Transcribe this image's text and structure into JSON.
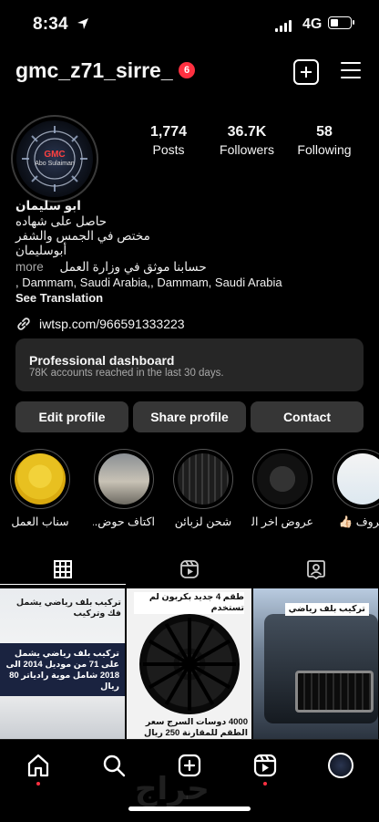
{
  "status_bar": {
    "time": "8:34",
    "network": "4G"
  },
  "header": {
    "username": "gmc_z71_sirre_",
    "notification_count": "6"
  },
  "avatar": {
    "logo_text": "GMC",
    "logo_subtext": "Abo Sulaiman"
  },
  "stats": [
    {
      "value": "1,774",
      "label": "Posts"
    },
    {
      "value": "36.7K",
      "label": "Followers"
    },
    {
      "value": "58",
      "label": "Following"
    }
  ],
  "bio": {
    "name": "ابو سليمان",
    "line1": "حاصل على شهاده",
    "line2": "مختص في الجمس والشفر",
    "line3": "أبوسليمان",
    "more_label": "more",
    "verified_line": "حسابنا موثق في وزارة العمل",
    "location": ", Dammam, Saudi Arabia,, Dammam, Saudi Arabia",
    "translation": "See Translation"
  },
  "link": {
    "text": "iwtsp.com/966591333223"
  },
  "dashboard": {
    "title": "Professional dashboard",
    "subtitle": "78K accounts reached in the last 30 days."
  },
  "buttons": {
    "edit": "Edit profile",
    "share": "Share profile",
    "contact": "Contact"
  },
  "highlights": [
    {
      "label": "سناب العمل"
    },
    {
      "label": "اكتاف حوض..."
    },
    {
      "label": "شحن لزبائن"
    },
    {
      "label": "عروض اخر السـ..."
    },
    {
      "label": "حروف 👍🏻"
    }
  ],
  "posts": [
    {
      "caption_top": "تركيب بلف رياضي يشمل فك وتركيب",
      "caption_bottom": "تركيب بلف رياضي يشمل على 71 من موديل 2014 الى 2018 شامل موية رادياتر 80 ريال"
    },
    {
      "caption_top": "طقم 4 جديد بكربون لم تستخدم",
      "caption_bottom": "4000 دوسات السرج سعر الطقم للمقارنة 250 ريال"
    },
    {
      "caption_top": "تركيب بلف رياضي",
      "caption_bottom": ""
    }
  ],
  "nav": {
    "watermark": "حراج"
  },
  "icons": {
    "location": "location-arrow-icon",
    "signal": "cellular-signal-icon",
    "battery": "battery-icon",
    "new_post": "plus-square-icon",
    "menu": "hamburger-menu-icon",
    "link": "link-chain-icon",
    "grid": "grid-icon",
    "reels": "reels-icon",
    "tagged": "tagged-person-icon",
    "home": "home-icon",
    "search": "search-icon",
    "create": "create-plus-icon",
    "profile": "profile-avatar-icon"
  }
}
